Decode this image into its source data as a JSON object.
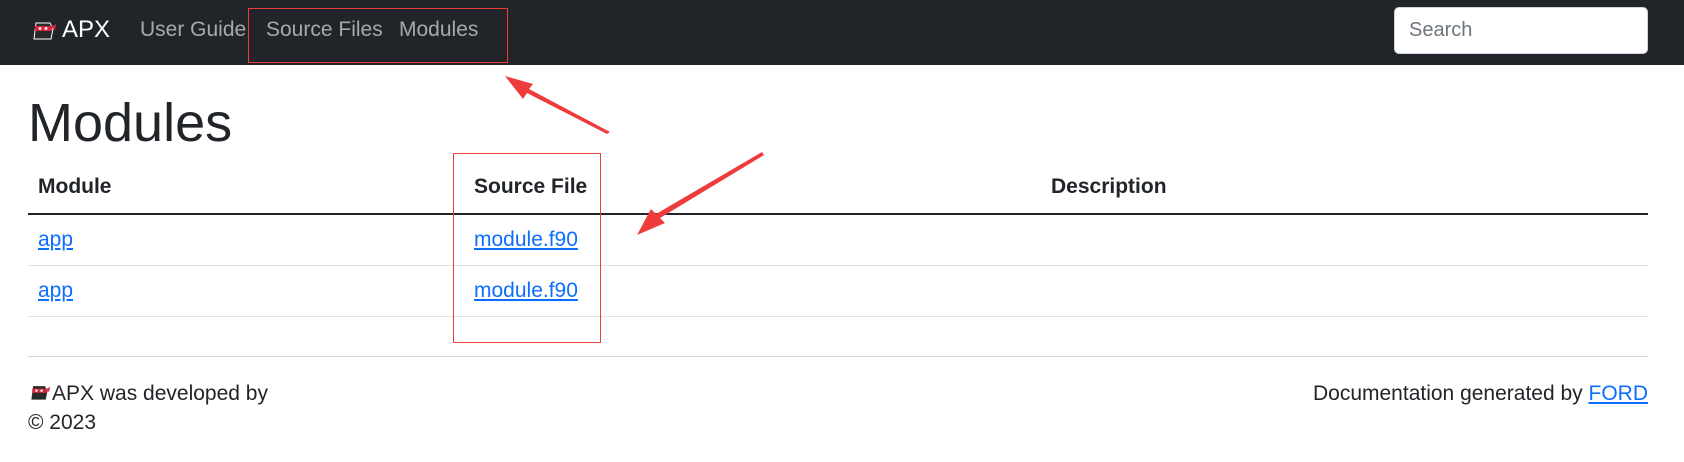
{
  "navbar": {
    "brand": "APX",
    "links": [
      "User Guide",
      "Source Files",
      "Modules"
    ],
    "search_placeholder": "Search"
  },
  "page": {
    "title": "Modules"
  },
  "table": {
    "headers": [
      "Module",
      "Source File",
      "Description"
    ],
    "rows": [
      {
        "module": "app",
        "source": "module.f90",
        "description": ""
      },
      {
        "module": "app",
        "source": "module.f90",
        "description": ""
      }
    ]
  },
  "footer": {
    "developed_by": "APX was developed by",
    "copyright": "© 2023",
    "generated_prefix": "Documentation generated by ",
    "generator_link": "FORD"
  },
  "icons": {
    "logo": "ninja-mask-logo-icon"
  },
  "colors": {
    "navbar_bg": "#212529",
    "link": "#0d6efd",
    "annotation": "#ee3b3b"
  }
}
